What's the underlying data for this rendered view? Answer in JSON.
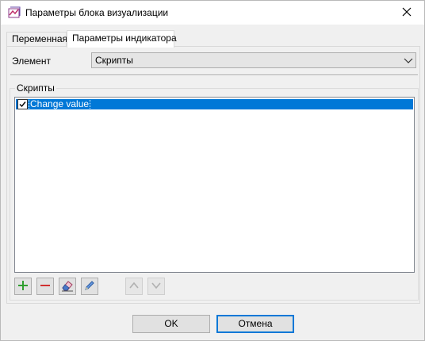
{
  "window": {
    "title": "Параметры блока визуализации",
    "icons": {
      "app": "visualization-app-icon",
      "close": "close-icon"
    }
  },
  "tabs": [
    {
      "label": "Переменная",
      "selected": false
    },
    {
      "label": "Параметры индикатора",
      "selected": true
    }
  ],
  "element_field": {
    "label": "Элемент",
    "value": "Скрипты"
  },
  "scripts_group": {
    "title": "Скрипты",
    "items": [
      {
        "label": "Change value",
        "checked": true,
        "selected": true
      }
    ]
  },
  "toolbar": {
    "buttons": [
      {
        "name": "add-icon",
        "enabled": true
      },
      {
        "name": "remove-icon",
        "enabled": true
      },
      {
        "name": "eraser-icon",
        "enabled": true
      },
      {
        "name": "edit-pencil-icon",
        "enabled": true
      },
      {
        "name": "move-up-icon",
        "enabled": false
      },
      {
        "name": "move-down-icon",
        "enabled": false
      }
    ]
  },
  "buttons": {
    "ok": "OK",
    "cancel": "Отмена"
  },
  "colors": {
    "selection": "#0078d7",
    "add": "#2e9e2e",
    "remove": "#d03030"
  }
}
